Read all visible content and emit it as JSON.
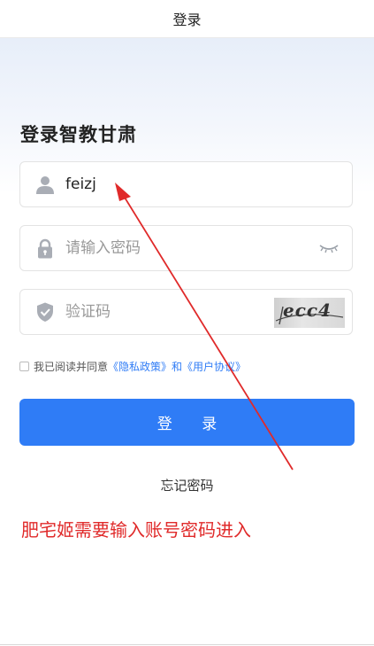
{
  "header": {
    "title": "登录"
  },
  "page": {
    "title": "登录智教甘肃"
  },
  "form": {
    "username": {
      "value": "feizj"
    },
    "password": {
      "placeholder": "请输入密码"
    },
    "captcha": {
      "placeholder": "验证码",
      "code": "ecc4"
    },
    "agreement": {
      "prefix": "我已阅读并同意",
      "privacy_link": "《隐私政策》",
      "and": "和",
      "user_link": "《用户协议》"
    },
    "login_button": "登 录",
    "forgot_password": "忘记密码"
  },
  "annotation": {
    "text": "肥宅姬需要输入账号密码进入",
    "color": "#e02a2a"
  },
  "colors": {
    "accent": "#2f7cf6",
    "annotation": "#e02a2a"
  },
  "icons": [
    "user-icon",
    "lock-icon",
    "eye-closed-icon",
    "shield-check-icon"
  ]
}
